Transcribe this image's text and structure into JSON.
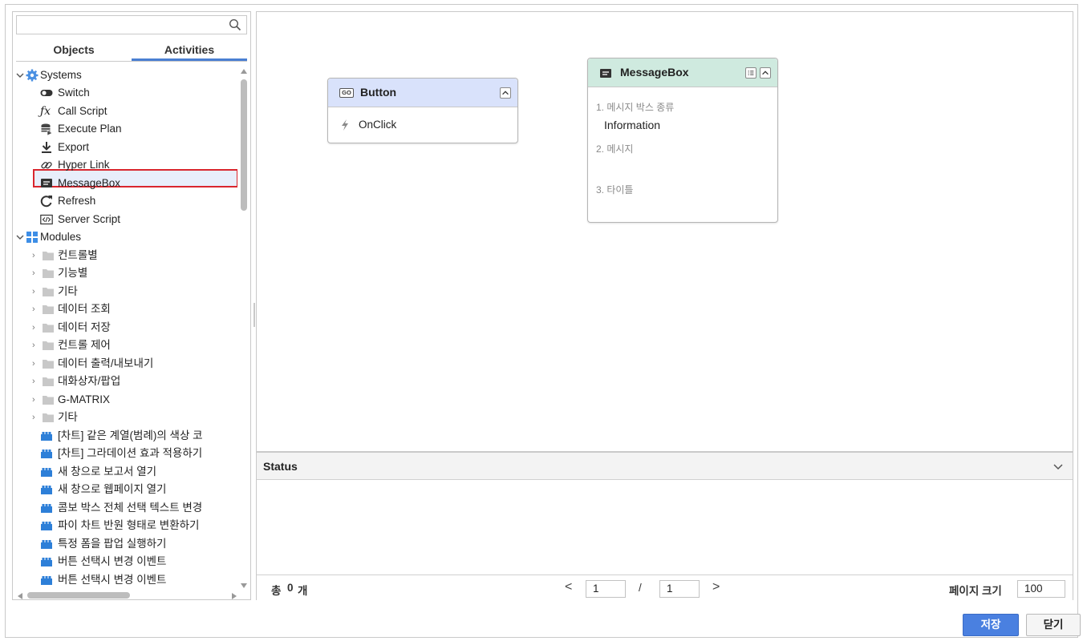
{
  "left_panel": {
    "search": {
      "value": "",
      "placeholder": ""
    },
    "tabs": [
      {
        "label": "Objects",
        "active": false
      },
      {
        "label": "Activities",
        "active": true
      }
    ],
    "systems": {
      "label": "Systems",
      "items": [
        {
          "label": "Switch",
          "icon": "switch-toggle-icon"
        },
        {
          "label": "Call Script",
          "icon": "function-fx-icon"
        },
        {
          "label": "Execute Plan",
          "icon": "database-execute-icon"
        },
        {
          "label": "Export",
          "icon": "download-icon"
        },
        {
          "label": "Hyper Link",
          "icon": "link-icon"
        },
        {
          "label": "MessageBox",
          "icon": "message-icon",
          "selected": true
        },
        {
          "label": "Refresh",
          "icon": "refresh-icon"
        },
        {
          "label": "Server Script",
          "icon": "code-icon"
        }
      ]
    },
    "modules": {
      "label": "Modules",
      "folders": [
        "컨트롤별",
        "기능별",
        "기타",
        "데이터 조회",
        "데이터 저장",
        "컨트롤 제어",
        "데이터 출력/내보내기",
        "대화상자/팝업",
        "G-MATRIX",
        "기타"
      ],
      "items": [
        "[차트] 같은 계열(범례)의 색상 코",
        "[차트] 그라데이션 효과 적용하기",
        "새 창으로 보고서 열기",
        "새 창으로 웹페이지 열기",
        "콤보 박스 전체 선택 텍스트 변경",
        "파이 차트 반원 형태로 변환하기",
        "특정 폼을 팝업 실행하기",
        "버튼 선택시 변경 이벤트",
        "버튼 선택시 변경 이벤트"
      ]
    }
  },
  "canvas": {
    "button_node": {
      "icon_text": "GO",
      "title": "Button",
      "event": "OnClick",
      "header_color": "#d9e2fb"
    },
    "messagebox_node": {
      "title": "MessageBox",
      "header_color": "#cfeadf",
      "params": [
        {
          "label": "1. 메시지 박스 종류",
          "value": "Information"
        },
        {
          "label": "2. 메시지",
          "value": ""
        },
        {
          "label": "3. 타이틀",
          "value": ""
        }
      ]
    }
  },
  "status": {
    "title": "Status",
    "pager": {
      "total_label": "총",
      "total_count": "0",
      "total_unit": "개",
      "current_page": "1",
      "separator": "/",
      "total_pages": "1",
      "page_size_label": "페이지 크기",
      "page_size": "100"
    }
  },
  "buttons": {
    "save": "저장",
    "close": "닫기"
  }
}
